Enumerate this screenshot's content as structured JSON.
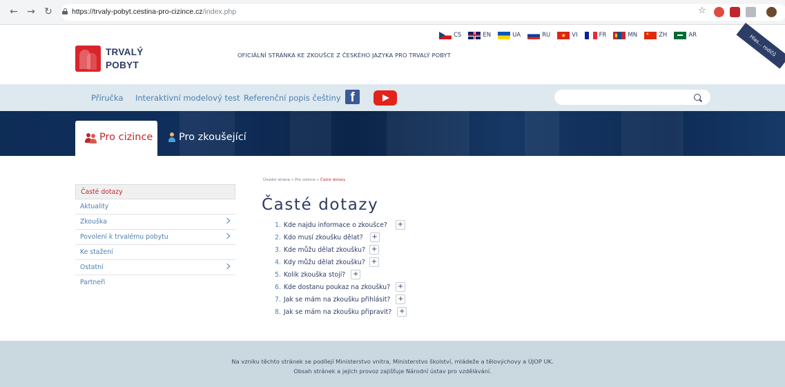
{
  "browser": {
    "url_host": "https://trvaly-pobyt.cestina-pro-cizince.cz",
    "url_path": "/index.php"
  },
  "header": {
    "logo_line1": "TRVALÝ",
    "logo_line2": "POBYT",
    "tagline": "OFICIÁLNÍ STRÁNKA KE ZKOUŠCE Z ČESKÉHO JAZYKA PRO TRVALÝ POBYT",
    "languages": [
      {
        "code": "CS",
        "colors": [
          "#ffffff",
          "#d7141a",
          "#11457e"
        ]
      },
      {
        "code": "EN",
        "colors": [
          "#012169",
          "#ffffff",
          "#c8102e"
        ]
      },
      {
        "code": "UA",
        "colors": [
          "#0057b7",
          "#ffd700"
        ]
      },
      {
        "code": "RU",
        "colors": [
          "#ffffff",
          "#0039a6",
          "#d52b1e"
        ]
      },
      {
        "code": "VI",
        "colors": [
          "#da251d",
          "#ffff00"
        ]
      },
      {
        "code": "FR",
        "colors": [
          "#002395",
          "#ffffff",
          "#ed2939"
        ]
      },
      {
        "code": "MN",
        "colors": [
          "#c4272f",
          "#015197",
          "#f9cf02"
        ]
      },
      {
        "code": "ZH",
        "colors": [
          "#de2910",
          "#ffde00"
        ]
      },
      {
        "code": "AR",
        "colors": [
          "#006c35",
          "#ffffff"
        ]
      }
    ],
    "ribbon_text": "Hlas... rodičů"
  },
  "nav": {
    "links": [
      "Příručka",
      "Interaktivní modelový test",
      "Referenční popis češtiny"
    ],
    "search_placeholder": ""
  },
  "tabs": {
    "active": "Pro cizince",
    "other": "Pro zkoušející"
  },
  "sidebar": {
    "items": [
      {
        "label": "Časté dotazy",
        "active": true,
        "chevron": false
      },
      {
        "label": "Aktuality",
        "active": false,
        "chevron": false
      },
      {
        "label": "Zkouška",
        "active": false,
        "chevron": true
      },
      {
        "label": "Povolení k trvalému pobytu",
        "active": false,
        "chevron": true
      },
      {
        "label": "Ke stažení",
        "active": false,
        "chevron": false
      },
      {
        "label": "Ostatní",
        "active": false,
        "chevron": true
      },
      {
        "label": "Partneři",
        "active": false,
        "chevron": false
      }
    ]
  },
  "main": {
    "breadcrumb_home": "Úvodní strana",
    "breadcrumb_sep": "»",
    "breadcrumb_mid": "Pro cizince",
    "breadcrumb_current": "Časté dotazy",
    "title": "Časté dotazy",
    "faq": [
      {
        "num": "1.",
        "q": "Kde najdu informace o zkoušce?"
      },
      {
        "num": "2.",
        "q": "Kdo musí zkoušku dělat?"
      },
      {
        "num": "3.",
        "q": "Kde můžu dělat zkoušku?"
      },
      {
        "num": "4.",
        "q": "Kdy můžu dělat zkoušku?"
      },
      {
        "num": "5.",
        "q": "Kolik zkouška stojí?"
      },
      {
        "num": "6.",
        "q": "Kde dostanu poukaz na zkoušku?"
      },
      {
        "num": "7.",
        "q": "Jak se mám na zkoušku přihlásit?"
      },
      {
        "num": "8.",
        "q": "Jak se mám na zkoušku připravit?"
      }
    ],
    "expand_symbol": "+"
  },
  "footer": {
    "line1": "Na vzniku těchto stránek se podílejí Ministerstvo vnitra, Ministerstvo školství, mládeže a tělovýchovy a ÚJOP UK.",
    "line2": "Obsah stránek a jejich provoz zajišťuje Národní ústav pro vzdělávání."
  }
}
